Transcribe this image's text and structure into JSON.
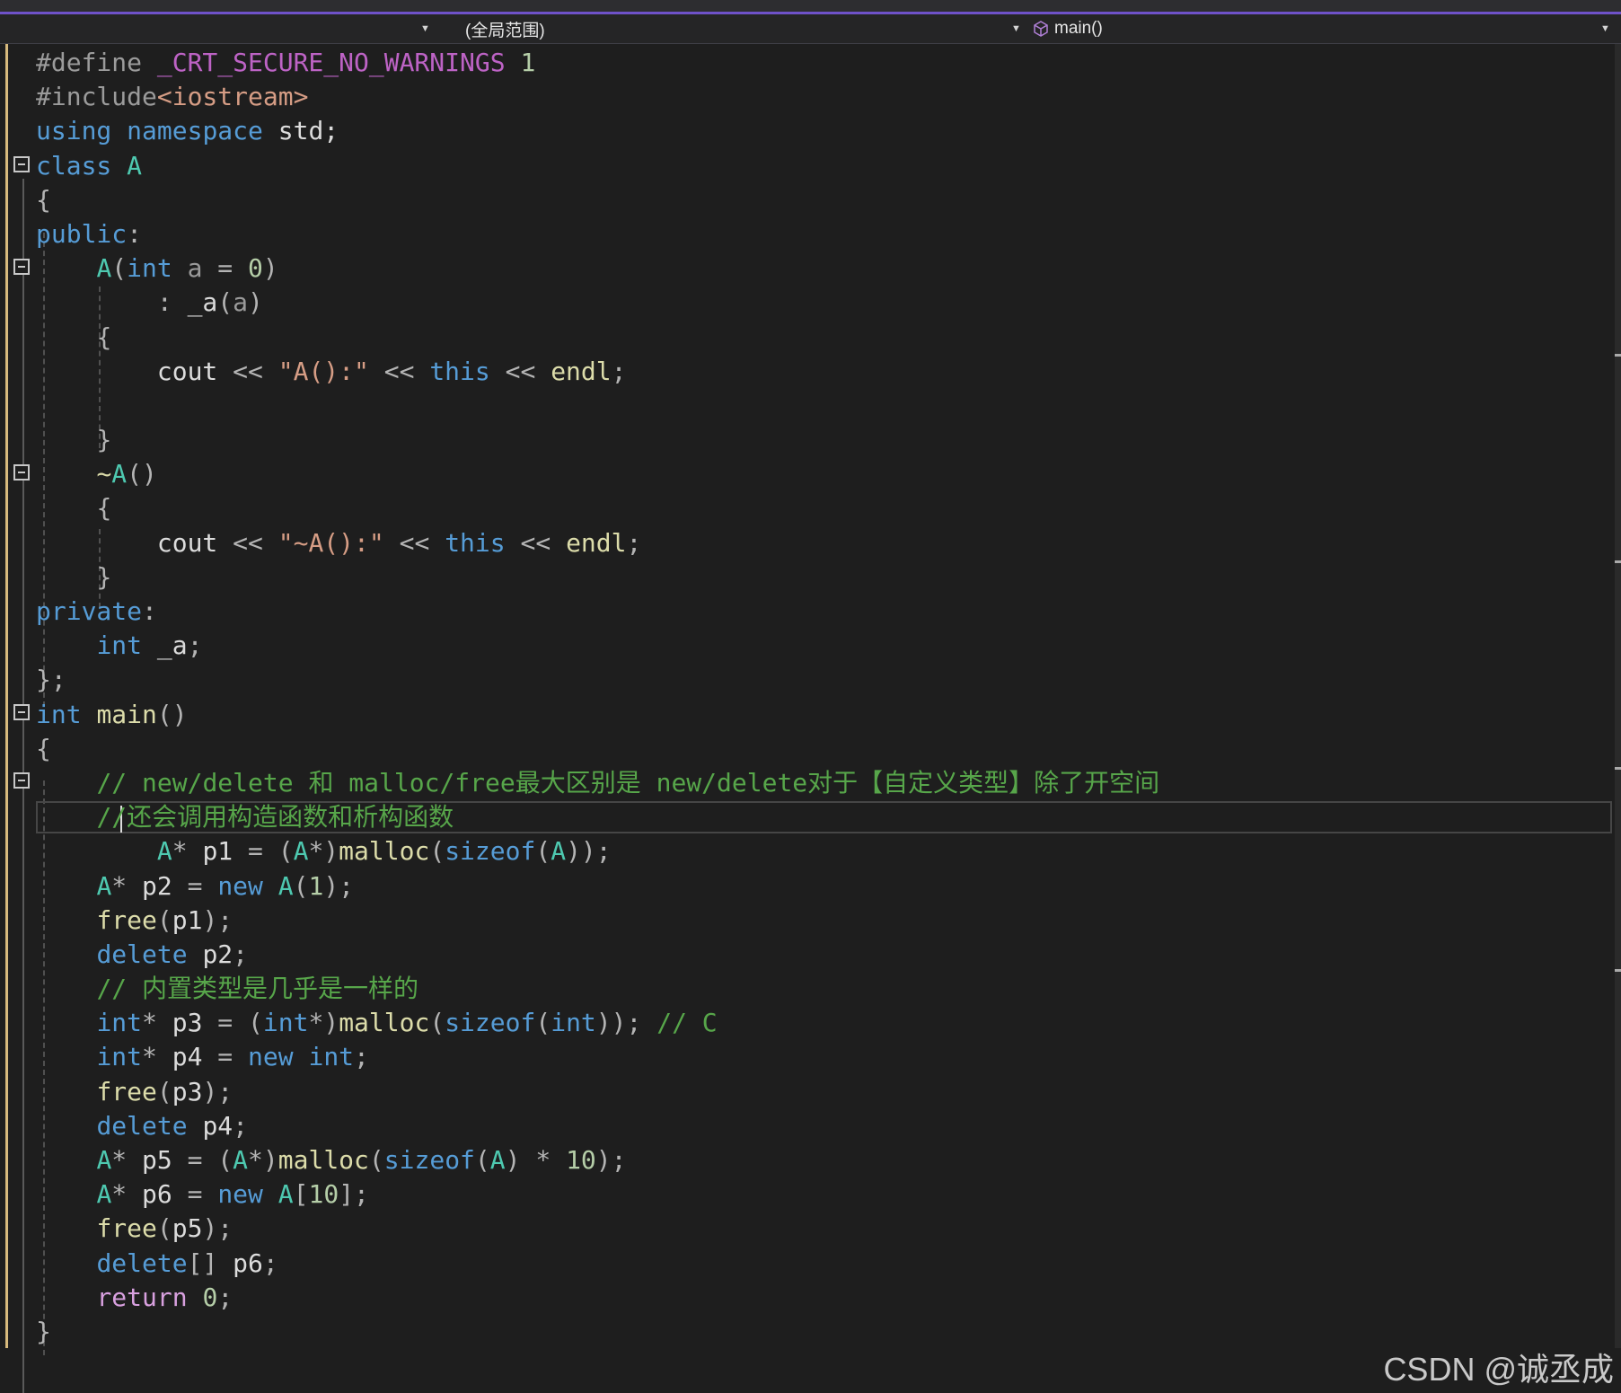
{
  "navbar": {
    "project_dropdown": "",
    "scope_dropdown": "(全局范围)",
    "function_dropdown": "main()",
    "function_icon": "cube-icon"
  },
  "editor": {
    "lines": [
      [
        [
          "pp",
          "#define "
        ],
        [
          "mac",
          "_CRT_SECURE_NO_WARNINGS"
        ],
        [
          "nm",
          " 1"
        ]
      ],
      [
        [
          "pp",
          "#include"
        ],
        [
          "inc",
          "<iostream>"
        ]
      ],
      [
        [
          "kw",
          "using"
        ],
        [
          "var",
          " "
        ],
        [
          "kw",
          "namespace"
        ],
        [
          "var",
          " std;"
        ]
      ],
      [
        [
          "kw",
          "class"
        ],
        [
          "var",
          " "
        ],
        [
          "ty",
          "A"
        ]
      ],
      [
        [
          "op",
          "{"
        ]
      ],
      [
        [
          "kw",
          "public"
        ],
        [
          "op",
          ":"
        ]
      ],
      [
        [
          "var",
          "    "
        ],
        [
          "ty",
          "A"
        ],
        [
          "op",
          "("
        ],
        [
          "kw",
          "int"
        ],
        [
          "prm",
          " a"
        ],
        [
          "op",
          " = "
        ],
        [
          "nm",
          "0"
        ],
        [
          "op",
          ")"
        ]
      ],
      [
        [
          "var",
          "        "
        ],
        [
          "op",
          ": "
        ],
        [
          "fld",
          "_a"
        ],
        [
          "op",
          "("
        ],
        [
          "prm",
          "a"
        ],
        [
          "op",
          ")"
        ]
      ],
      [
        [
          "var",
          "    "
        ],
        [
          "op",
          "{"
        ]
      ],
      [
        [
          "var",
          "        "
        ],
        [
          "var",
          "cout"
        ],
        [
          "op",
          " << "
        ],
        [
          "st",
          "\"A():\""
        ],
        [
          "op",
          " << "
        ],
        [
          "kw",
          "this"
        ],
        [
          "op",
          " << "
        ],
        [
          "fn",
          "endl"
        ],
        [
          "op",
          ";"
        ]
      ],
      [
        [
          "var",
          ""
        ]
      ],
      [
        [
          "var",
          "    "
        ],
        [
          "op",
          "}"
        ]
      ],
      [
        [
          "var",
          "    "
        ],
        [
          "fn",
          "~"
        ],
        [
          "ty",
          "A"
        ],
        [
          "op",
          "()"
        ]
      ],
      [
        [
          "var",
          "    "
        ],
        [
          "op",
          "{"
        ]
      ],
      [
        [
          "var",
          "        "
        ],
        [
          "var",
          "cout"
        ],
        [
          "op",
          " << "
        ],
        [
          "st",
          "\"~A():\""
        ],
        [
          "op",
          " << "
        ],
        [
          "kw",
          "this"
        ],
        [
          "op",
          " << "
        ],
        [
          "fn",
          "endl"
        ],
        [
          "op",
          ";"
        ]
      ],
      [
        [
          "var",
          "    "
        ],
        [
          "op",
          "}"
        ]
      ],
      [
        [
          "kw",
          "private"
        ],
        [
          "op",
          ":"
        ]
      ],
      [
        [
          "var",
          "    "
        ],
        [
          "kw",
          "int"
        ],
        [
          "fld",
          " _a"
        ],
        [
          "op",
          ";"
        ]
      ],
      [
        [
          "op",
          "};"
        ]
      ],
      [
        [
          "kw",
          "int"
        ],
        [
          "var",
          " "
        ],
        [
          "fn",
          "main"
        ],
        [
          "op",
          "()"
        ]
      ],
      [
        [
          "op",
          "{"
        ]
      ],
      [
        [
          "var",
          "    "
        ],
        [
          "cm",
          "// new/delete 和 malloc/free最大区别是 new/delete对于【自定义类型】除了开空间"
        ]
      ],
      [
        [
          "var",
          "    "
        ],
        [
          "cm",
          "//还会调用构造函数和析构函数"
        ]
      ],
      [
        [
          "var",
          "        "
        ],
        [
          "ty",
          "A"
        ],
        [
          "op",
          "* "
        ],
        [
          "var",
          "p1"
        ],
        [
          "op",
          " = ("
        ],
        [
          "ty",
          "A"
        ],
        [
          "op",
          "*)"
        ],
        [
          "fn",
          "malloc"
        ],
        [
          "op",
          "("
        ],
        [
          "kw",
          "sizeof"
        ],
        [
          "op",
          "("
        ],
        [
          "ty",
          "A"
        ],
        [
          "op",
          "));"
        ]
      ],
      [
        [
          "var",
          "    "
        ],
        [
          "ty",
          "A"
        ],
        [
          "op",
          "* "
        ],
        [
          "var",
          "p2"
        ],
        [
          "op",
          " = "
        ],
        [
          "kw",
          "new"
        ],
        [
          "var",
          " "
        ],
        [
          "ty",
          "A"
        ],
        [
          "op",
          "("
        ],
        [
          "nm",
          "1"
        ],
        [
          "op",
          ");"
        ]
      ],
      [
        [
          "var",
          "    "
        ],
        [
          "fn",
          "free"
        ],
        [
          "op",
          "("
        ],
        [
          "var",
          "p1"
        ],
        [
          "op",
          ");"
        ]
      ],
      [
        [
          "var",
          "    "
        ],
        [
          "kw",
          "delete"
        ],
        [
          "var",
          " p2"
        ],
        [
          "op",
          ";"
        ]
      ],
      [
        [
          "var",
          "    "
        ],
        [
          "cm",
          "// 内置类型是几乎是一样的"
        ]
      ],
      [
        [
          "var",
          "    "
        ],
        [
          "kw",
          "int"
        ],
        [
          "op",
          "* "
        ],
        [
          "var",
          "p3"
        ],
        [
          "op",
          " = ("
        ],
        [
          "kw",
          "int"
        ],
        [
          "op",
          "*)"
        ],
        [
          "fn",
          "malloc"
        ],
        [
          "op",
          "("
        ],
        [
          "kw",
          "sizeof"
        ],
        [
          "op",
          "("
        ],
        [
          "kw",
          "int"
        ],
        [
          "op",
          "));"
        ],
        [
          "cm",
          " // C"
        ]
      ],
      [
        [
          "var",
          "    "
        ],
        [
          "kw",
          "int"
        ],
        [
          "op",
          "* "
        ],
        [
          "var",
          "p4"
        ],
        [
          "op",
          " = "
        ],
        [
          "kw",
          "new"
        ],
        [
          "var",
          " "
        ],
        [
          "kw",
          "int"
        ],
        [
          "op",
          ";"
        ]
      ],
      [
        [
          "var",
          "    "
        ],
        [
          "fn",
          "free"
        ],
        [
          "op",
          "("
        ],
        [
          "var",
          "p3"
        ],
        [
          "op",
          ");"
        ]
      ],
      [
        [
          "var",
          "    "
        ],
        [
          "kw",
          "delete"
        ],
        [
          "var",
          " p4"
        ],
        [
          "op",
          ";"
        ]
      ],
      [
        [
          "var",
          "    "
        ],
        [
          "ty",
          "A"
        ],
        [
          "op",
          "* "
        ],
        [
          "var",
          "p5"
        ],
        [
          "op",
          " = ("
        ],
        [
          "ty",
          "A"
        ],
        [
          "op",
          "*)"
        ],
        [
          "fn",
          "malloc"
        ],
        [
          "op",
          "("
        ],
        [
          "kw",
          "sizeof"
        ],
        [
          "op",
          "("
        ],
        [
          "ty",
          "A"
        ],
        [
          "op",
          ") * "
        ],
        [
          "nm",
          "10"
        ],
        [
          "op",
          ");"
        ]
      ],
      [
        [
          "var",
          "    "
        ],
        [
          "ty",
          "A"
        ],
        [
          "op",
          "* "
        ],
        [
          "var",
          "p6"
        ],
        [
          "op",
          " = "
        ],
        [
          "kw",
          "new"
        ],
        [
          "var",
          " "
        ],
        [
          "ty",
          "A"
        ],
        [
          "op",
          "["
        ],
        [
          "nm",
          "10"
        ],
        [
          "op",
          "];"
        ]
      ],
      [
        [
          "var",
          "    "
        ],
        [
          "fn",
          "free"
        ],
        [
          "op",
          "("
        ],
        [
          "var",
          "p5"
        ],
        [
          "op",
          ");"
        ]
      ],
      [
        [
          "var",
          "    "
        ],
        [
          "kw",
          "delete"
        ],
        [
          "op",
          "[] "
        ],
        [
          "var",
          "p6"
        ],
        [
          "op",
          ";"
        ]
      ],
      [
        [
          "var",
          "    "
        ],
        [
          "ctl",
          "return"
        ],
        [
          "var",
          " "
        ],
        [
          "nm",
          "0"
        ],
        [
          "op",
          ";"
        ]
      ],
      [
        [
          "op",
          "}"
        ]
      ]
    ],
    "current_line": 23
  },
  "watermark": "CSDN @诚丞成"
}
